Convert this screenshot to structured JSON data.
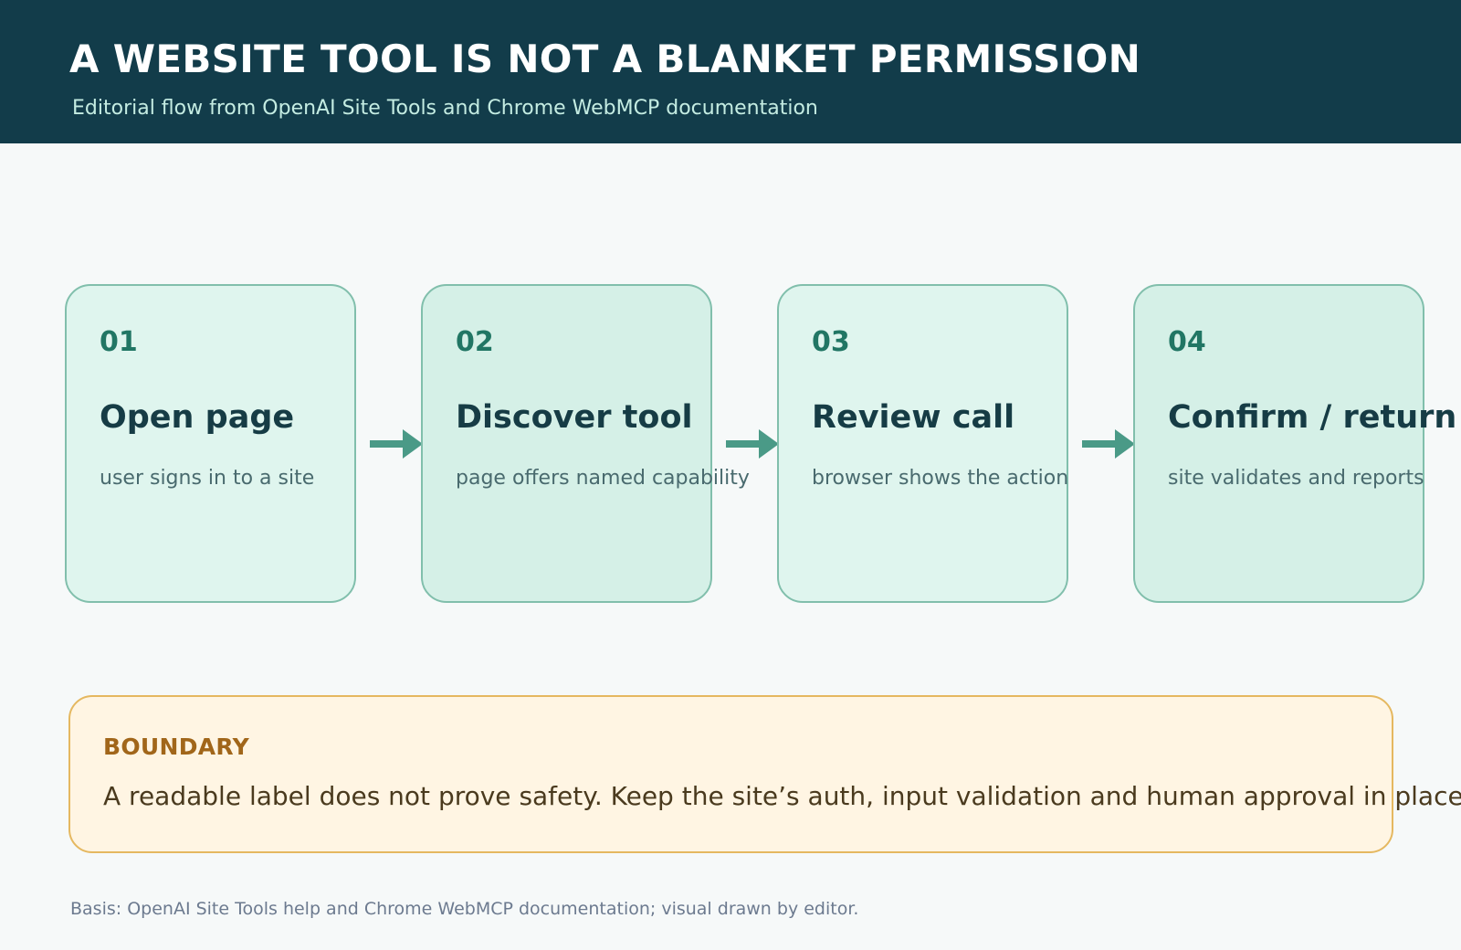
{
  "header": {
    "title": "A WEBSITE TOOL IS NOT A BLANKET PERMISSION",
    "subtitle": "Editorial flow from OpenAI Site Tools and Chrome WebMCP documentation"
  },
  "steps": [
    {
      "number": "01",
      "title": "Open page",
      "description": "user signs in to a site"
    },
    {
      "number": "02",
      "title": "Discover tool",
      "description": "page offers named capability"
    },
    {
      "number": "03",
      "title": "Review call",
      "description": "browser shows the action"
    },
    {
      "number": "04",
      "title": "Confirm / return",
      "description": "site validates and reports"
    }
  ],
  "boundary": {
    "label": "BOUNDARY",
    "text": "A readable label does not prove safety. Keep the site’s auth, input validation and human approval in place."
  },
  "footer": {
    "note": "Basis: OpenAI Site Tools help and Chrome WebMCP documentation; visual drawn by editor."
  },
  "colors": {
    "header_bg": "#123c4a",
    "accent": "#217664",
    "arrow": "#4a9a87",
    "boundary_border": "#e5b860"
  }
}
